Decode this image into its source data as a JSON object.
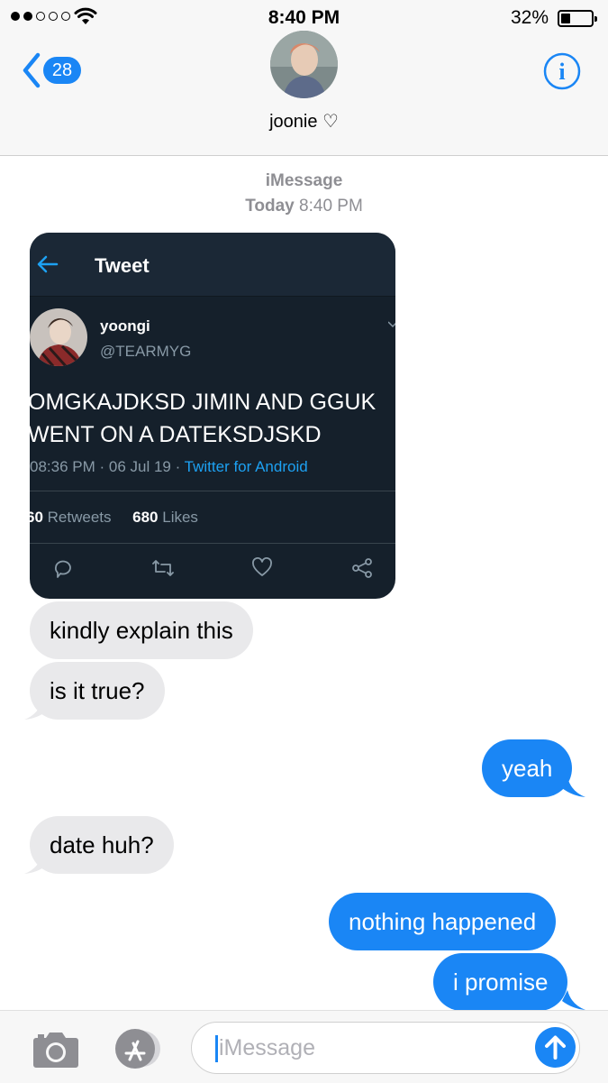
{
  "status_bar": {
    "time": "8:40 PM",
    "battery_percent": "32%",
    "battery_level": 0.32,
    "signal_bars_filled": 2,
    "signal_bars_total": 5,
    "icons": [
      "signal-dots-icon",
      "wifi-icon",
      "battery-icon"
    ]
  },
  "header": {
    "back_badge": "28",
    "contact_name": "joonie ♡",
    "icons": [
      "back-chevron-icon",
      "info-icon"
    ]
  },
  "meta": {
    "service": "iMessage",
    "day": "Today",
    "time": "8:40 PM"
  },
  "tweet": {
    "title": "Tweet",
    "name": "yoongi",
    "handle": "@TEARMYG",
    "text_line1": "OMGKAJDKSD JIMIN AND GGUK",
    "text_line2": "WENT ON A DATEKSDJSKD",
    "meta_time": "08:36 PM · 06 Jul 19 · ",
    "meta_app": "Twitter for Android",
    "retweets_count": "60",
    "retweets_label": " Retweets",
    "likes_count": "680",
    "likes_label": " Likes",
    "icons": [
      "back-arrow-icon",
      "reply-icon",
      "retweet-icon",
      "like-icon",
      "share-icon",
      "chevron-down-icon"
    ]
  },
  "messages": [
    {
      "direction": "incoming",
      "text": "kindly explain this"
    },
    {
      "direction": "incoming",
      "text": "is it true?"
    },
    {
      "direction": "outgoing",
      "text": "yeah"
    },
    {
      "direction": "incoming",
      "text": "date huh?"
    },
    {
      "direction": "outgoing",
      "text": "nothing happened"
    },
    {
      "direction": "outgoing",
      "text": "i promise"
    }
  ],
  "input_bar": {
    "placeholder": "iMessage",
    "icons": [
      "camera-icon",
      "app-store-icon",
      "send-arrow-icon"
    ]
  },
  "colors": {
    "accent_blue": "#1a86f5",
    "incoming_bubble": "#e9e9eb",
    "tweet_background": "#15202b",
    "twitter_blue": "#1da1f2"
  }
}
